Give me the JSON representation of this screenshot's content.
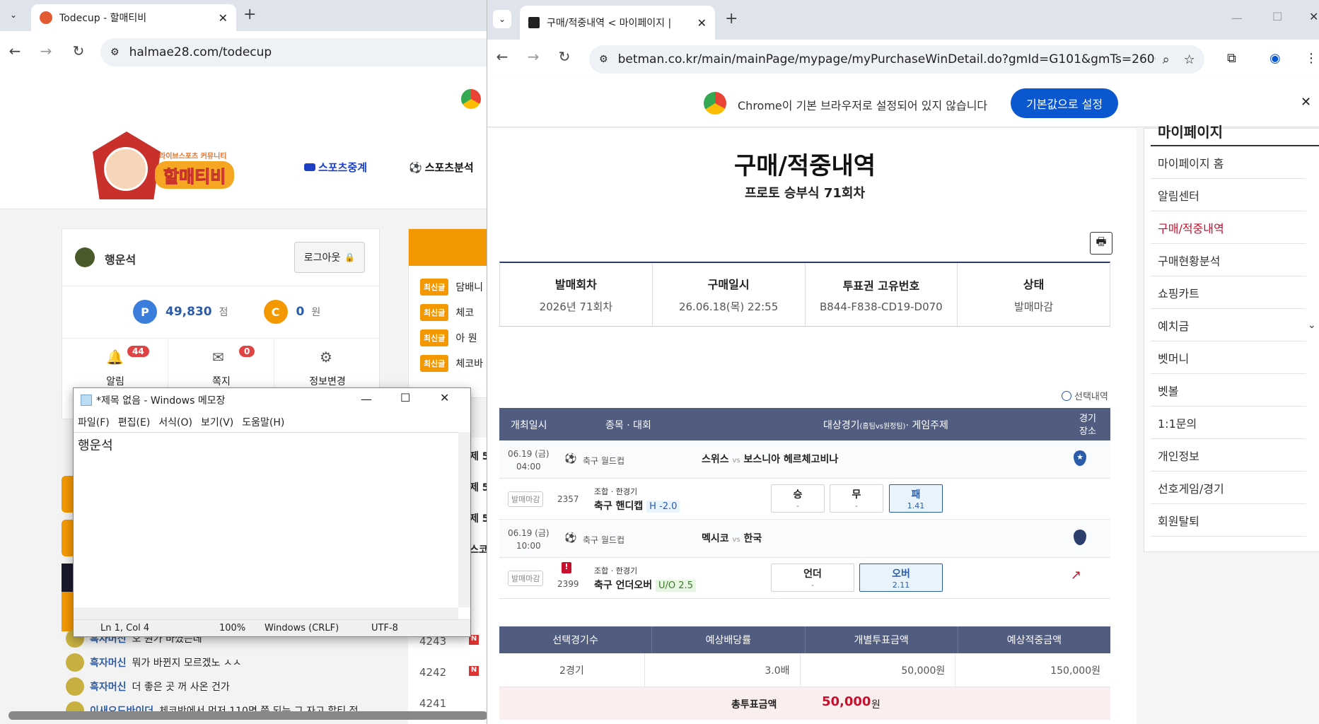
{
  "left_browser": {
    "tab_title": "Todecup - 할매티비",
    "url": "halmae28.com/todecup",
    "site": {
      "logo_sub": "라이브스포츠 커뮤니티",
      "logo_main": "할매티비",
      "nav": [
        "스포츠중계",
        "스포츠분석"
      ],
      "user_name": "행운석",
      "logout_label": "로그아웃",
      "point_badge": "P",
      "points": "49,830",
      "points_unit": "점",
      "cash_badge": "C",
      "cash": "0",
      "cash_unit": "원",
      "quick": [
        {
          "label": "알림",
          "badge": "44",
          "icon": "bell-icon"
        },
        {
          "label": "쪽지",
          "badge": "0",
          "icon": "envelope-icon"
        },
        {
          "label": "정보변경",
          "badge": "",
          "icon": "gear-icon"
        }
      ],
      "latest_tag": "최신글",
      "latest_posts": [
        "담배니",
        "체코",
        "아 뭔",
        "체코바"
      ],
      "side_peeks": [
        "제 5",
        "제 5",
        "제 5",
        "스코"
      ],
      "chat": [
        {
          "user": "흑자머신",
          "msg": "오 뭔가 바꼈는데"
        },
        {
          "user": "흑자머신",
          "msg": "뭐가 바뀐지 모르겠노 ㅅㅅ"
        },
        {
          "user": "흑자머신",
          "msg": "더 좋은 곳 꺼 사온 건가"
        },
        {
          "user": "이새오드바이더",
          "msg": "체코반에서 먼저 110명 쯤 되는 그 자고 할티 적"
        }
      ],
      "ids": [
        "4243",
        "4242",
        "4241"
      ]
    }
  },
  "notepad": {
    "title": "*제목 없음 - Windows 메모장",
    "menu": [
      "파일(F)",
      "편집(E)",
      "서식(O)",
      "보기(V)",
      "도움말(H)"
    ],
    "content": "행운석",
    "status": [
      "Ln 1, Col 4",
      "100%",
      "Windows (CRLF)",
      "UTF-8"
    ]
  },
  "right_browser": {
    "tab_title": "구매/적중내역 < 마이페이지 | ",
    "url": "betman.co.kr/main/mainPage/mypage/myPurchaseWinDetail.do?gmId=G101&gmTs=26007...",
    "infobar_text": "Chrome이 기본 브라우저로 설정되어 있지 않습니다",
    "infobar_button": "기본값으로 설정",
    "page_title": "구매/적중내역",
    "page_subtitle": "프로토 승부식 71회차",
    "info_table": {
      "headers": [
        "발매회차",
        "구매일시",
        "투표권 고유번호",
        "상태"
      ],
      "values": [
        "2026년 71회차",
        "26.06.18(목) 22:55",
        "B844-F838-CD19-D070",
        "발매마감"
      ]
    },
    "selected_check": "선택내역",
    "games_table": {
      "headers": [
        "개최일시",
        "종목 · 대회",
        "대상경기",
        "(홈팀vs원정팀)",
        "· 게임주제",
        "경기",
        "장소"
      ],
      "games": [
        {
          "date": "06.19 (금)",
          "time": "04:00",
          "sport": "축구 월드컵",
          "home": "스위스",
          "vs": "vs",
          "away": "보스니아 헤르체고비나",
          "status": "발매마감",
          "no": "2357",
          "type": "조합 · 한경기",
          "bet": "축구 핸디캡",
          "line": "H -2.0",
          "options": [
            {
              "label": "승",
              "odds": "-"
            },
            {
              "label": "무",
              "odds": "-"
            },
            {
              "label": "패",
              "odds": "1.41"
            }
          ]
        },
        {
          "date": "06.19 (금)",
          "time": "10:00",
          "sport": "축구 월드컵",
          "home": "멕시코",
          "vs": "vs",
          "away": "한국",
          "status": "발매마감",
          "no": "2399",
          "type": "조합 · 한경기",
          "bet": "축구 언더오버",
          "line": "U/O 2.5",
          "options": [
            {
              "label": "언더",
              "odds": "-"
            },
            {
              "label": "오버",
              "odds": "2.11"
            }
          ]
        }
      ]
    },
    "summary_table": {
      "headers": [
        "선택경기수",
        "예상배당률",
        "개별투표금액",
        "예상적중금액"
      ],
      "values": [
        "2경기",
        "3.0배",
        "50,000원",
        "150,000원"
      ],
      "total_label": "총투표금액",
      "total_value": "50,000",
      "total_unit": "원"
    },
    "sidebar": {
      "title_peek": "마이페이지",
      "items": [
        "마이페이지 홈",
        "알림센터",
        "구매/적중내역",
        "구매현황분석",
        "쇼핑카트",
        "예치금",
        "벳머니",
        "벳볼",
        "1:1문의",
        "개인정보",
        "선호게임/경기",
        "회원탈퇴"
      ],
      "active_index": 2
    }
  },
  "colors": {
    "site_orange": "#f39800",
    "betman_navy": "#515d80",
    "accent_red": "#c8102e",
    "chrome_blue": "#0b57d0"
  }
}
